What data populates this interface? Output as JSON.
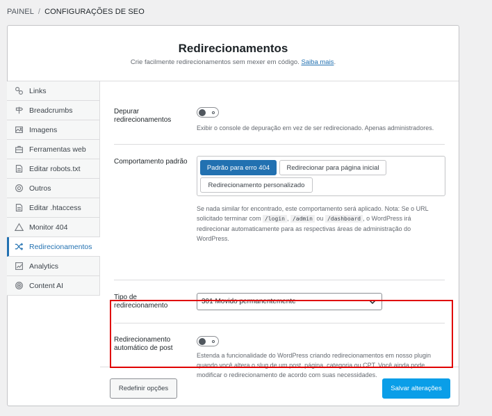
{
  "breadcrumb": {
    "root": "PAINEL",
    "separator": "/",
    "current": "CONFIGURAÇÕES DE SEO"
  },
  "header": {
    "title": "Redirecionamentos",
    "subtitle": "Crie facilmente redirecionamentos sem mexer em código.",
    "link": "Saiba mais",
    "link_suffix": "."
  },
  "sidebar": {
    "items": [
      {
        "label": "Links",
        "icon": "link-icon"
      },
      {
        "label": "Breadcrumbs",
        "icon": "signpost-icon"
      },
      {
        "label": "Imagens",
        "icon": "images-icon"
      },
      {
        "label": "Ferramentas web",
        "icon": "toolbox-icon"
      },
      {
        "label": "Editar robots.txt",
        "icon": "document-icon"
      },
      {
        "label": "Outros",
        "icon": "circle-icon"
      },
      {
        "label": "Editar .htaccess",
        "icon": "document-icon"
      },
      {
        "label": "Monitor 404",
        "icon": "warning-icon"
      },
      {
        "label": "Redirecionamentos",
        "icon": "shuffle-icon",
        "active": true
      },
      {
        "label": "Analytics",
        "icon": "chart-icon"
      },
      {
        "label": "Content AI",
        "icon": "ai-icon"
      }
    ]
  },
  "debug": {
    "label": "Depurar redirecionamentos",
    "enabled": false,
    "help": "Exibir o console de depuração em vez de ser redirecionado. Apenas administradores."
  },
  "fallback": {
    "label": "Comportamento padrão",
    "options": [
      "Padrão para erro 404",
      "Redirecionar para página inicial",
      "Redirecionamento personalizado"
    ],
    "selected": "Padrão para erro 404",
    "help_part1": "Se nada similar for encontrado, este comportamento será aplicado. Nota: Se o URL solicitado terminar com",
    "code1": "/login",
    "comma": ",",
    "code2": "/admin",
    "or": "ou",
    "code3": "/dashboard",
    "help_part2": ", o WordPress irá redirecionar automaticamente para as respectivas áreas de administração do WordPress."
  },
  "redirect_type": {
    "label": "Tipo de redirecionamento",
    "value": "301 Movido permanentemente"
  },
  "auto_post": {
    "label": "Redirecionamento automático de post",
    "enabled": false,
    "help": "Estenda a funcionalidade do WordPress criando redirecionamentos em nosso plugin quando você altera o slug de um post, página, categoria ou CPT. Você ainda pode modificar o redirecionamento de acordo com suas necessidades."
  },
  "footer": {
    "reset_label": "Redefinir opções",
    "save_label": "Salvar alterações"
  },
  "colors": {
    "accent": "#2271b1",
    "primary_button": "#0a9ee8",
    "highlight": "#e00000"
  }
}
